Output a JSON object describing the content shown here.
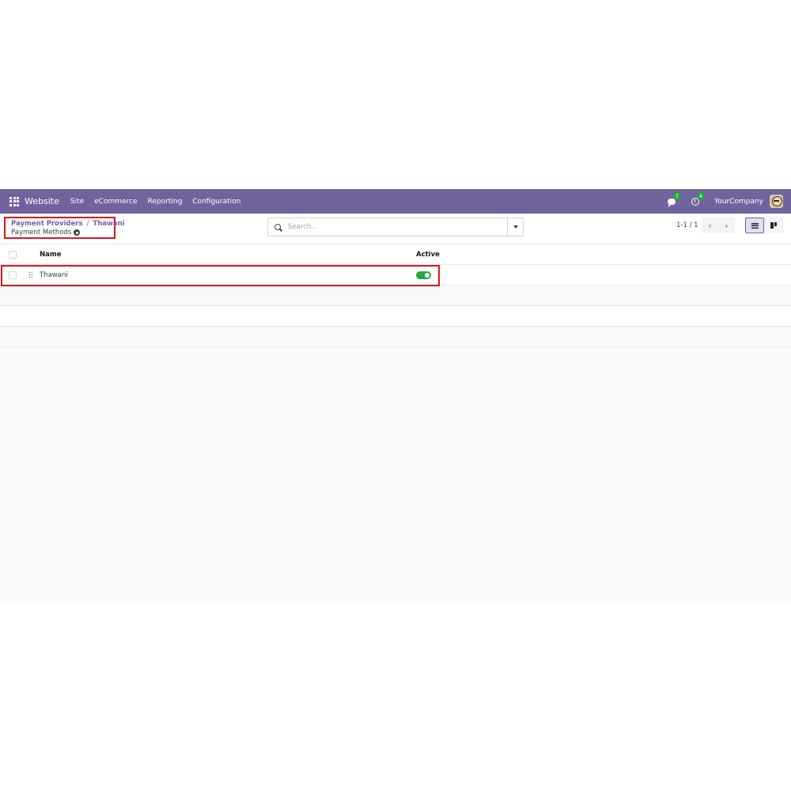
{
  "navbar": {
    "app_name": "Website",
    "menu": [
      "Site",
      "eCommerce",
      "Reporting",
      "Configuration"
    ],
    "messages_count": "7",
    "activities_count": "4",
    "company": "YourCompany",
    "bg_color": "#71639e"
  },
  "breadcrumb": {
    "items": [
      "Payment Providers",
      "Thawani"
    ],
    "separator": "/",
    "current": "Payment Methods"
  },
  "search": {
    "placeholder": "Search..."
  },
  "pager": {
    "text": "1-1 / 1"
  },
  "view_switcher": {
    "active": "list"
  },
  "table": {
    "columns": [
      "Name",
      "Active"
    ],
    "rows": [
      {
        "name": "Thawani",
        "active": true
      }
    ]
  },
  "colors": {
    "accent": "#71639e",
    "toggle_on": "#28a745",
    "highlight": "#e0141e"
  }
}
